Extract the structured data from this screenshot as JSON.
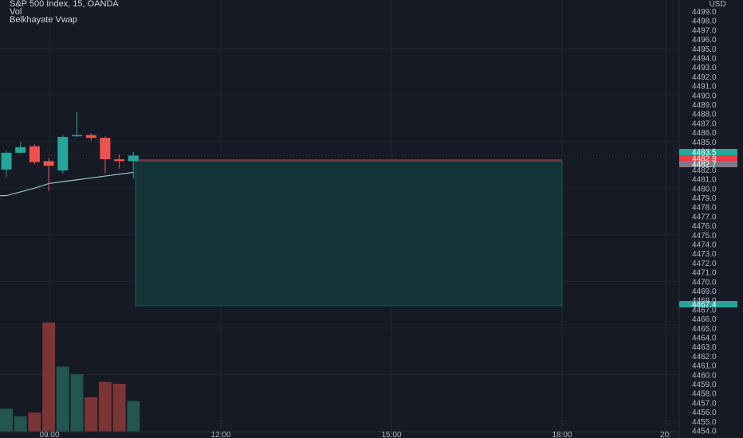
{
  "legend": {
    "symbol": "S&P 500 Index, 15, OANDA",
    "volume": "Vol",
    "indicator": "Belkhayate Vwap"
  },
  "chart_data": {
    "type": "candlestick",
    "currency": "USD",
    "y_ticks": [
      4499,
      4498,
      4497,
      4496,
      4495,
      4494,
      4493,
      4492,
      4491,
      4490,
      4489,
      4488,
      4487,
      4486,
      4485,
      4484,
      4483,
      4482,
      4481,
      4480,
      4479,
      4478,
      4477,
      4476,
      4475,
      4474,
      4473,
      4472,
      4471,
      4470,
      4469,
      4468,
      4467,
      4466,
      4465,
      4464,
      4463,
      4462,
      4461,
      4460,
      4459,
      4458,
      4457,
      4456,
      4455,
      4454
    ],
    "x_tick_labels": [
      "09:00",
      "12:00",
      "15:00",
      "18:00",
      "20:"
    ],
    "candles": [
      {
        "o": 4482.0,
        "h": 4484.0,
        "l": 4481.2,
        "c": 4483.8,
        "v": 1200
      },
      {
        "o": 4483.8,
        "h": 4484.9,
        "l": 4483.7,
        "c": 4484.4,
        "v": 800
      },
      {
        "o": 4484.5,
        "h": 4484.7,
        "l": 4482.6,
        "c": 4482.8,
        "v": 1000
      },
      {
        "o": 4482.9,
        "h": 4483.2,
        "l": 4479.7,
        "c": 4482.4,
        "v": 5700
      },
      {
        "o": 4481.9,
        "h": 4485.7,
        "l": 4481.6,
        "c": 4485.5,
        "v": 3400
      },
      {
        "o": 4485.6,
        "h": 4488.2,
        "l": 4485.5,
        "c": 4485.7,
        "v": 3000
      },
      {
        "o": 4485.7,
        "h": 4485.9,
        "l": 4485.1,
        "c": 4485.4,
        "v": 1800
      },
      {
        "o": 4485.4,
        "h": 4485.6,
        "l": 4481.6,
        "c": 4483.1,
        "v": 2600
      },
      {
        "o": 4483.1,
        "h": 4483.6,
        "l": 4482.1,
        "c": 4482.9,
        "v": 2500
      },
      {
        "o": 4482.9,
        "h": 4483.9,
        "l": 4481.0,
        "c": 4483.5,
        "v": 1600
      }
    ],
    "vwap": [
      4479.2,
      4479.6,
      4480.0,
      4480.5,
      4480.7,
      4480.9,
      4481.1,
      4481.3,
      4481.5,
      4481.7
    ],
    "position": {
      "entry": 4482.9,
      "stop": 4483.1,
      "target": 4467.4
    },
    "price_labels": [
      {
        "text": "4483.5",
        "color": "#26a69a"
      },
      {
        "text": "4482.9",
        "color": "#f23645"
      },
      {
        "text": "4482.7",
        "color": "#787b86"
      },
      {
        "text": "4467.4",
        "color": "#26a69a"
      }
    ],
    "colors": {
      "up": "#26a69a",
      "down": "#ef5350",
      "vol_up": "#22564f",
      "vol_down": "#7b3535",
      "vwap": "#8ec7c1",
      "target_zone": "#133436",
      "target_border": "#1c5c5c"
    }
  }
}
